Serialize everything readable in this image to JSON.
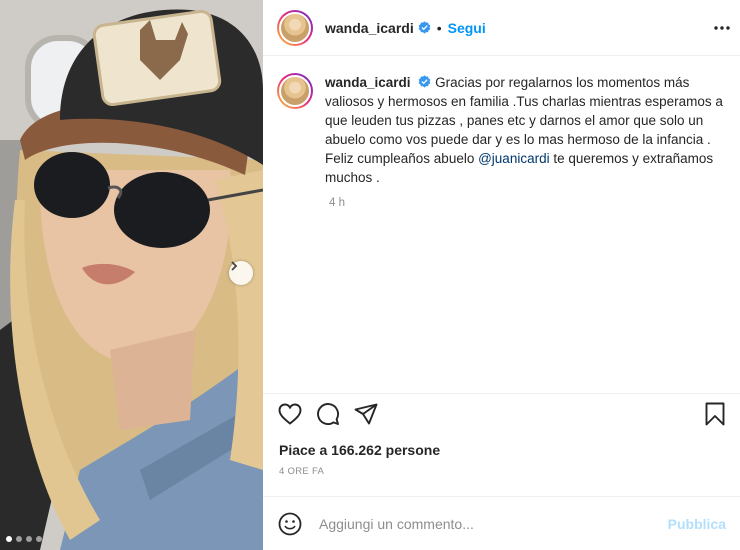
{
  "post": {
    "image_alt": "",
    "carousel_dots": 4,
    "carousel_active": 0
  },
  "header": {
    "username": "wanda_icardi",
    "verified": true,
    "separator": "•",
    "follow_label": "Segui"
  },
  "caption": {
    "username": "wanda_icardi",
    "text_part1": "Gracias por regalarnos los momentos más valiosos y hermosos en familia .Tus charlas mientras esperamos a que leuden tus pizzas , panes etc y darnos el amor que solo un abuelo como vos puede dar y es lo mas hermoso de la infancia . Feliz cumpleaños abuelo ",
    "mention": "@juanicardi",
    "text_part2": " te queremos y extrañamos muchos .",
    "time": "4 h"
  },
  "actions": {
    "like_icon": "heart-icon",
    "comment_icon": "comment-icon",
    "share_icon": "paper-plane-icon",
    "save_icon": "bookmark-icon"
  },
  "likes_text": "Piace a 166.262 persone",
  "time_ago": "4 ORE FA",
  "comment_box": {
    "placeholder": "Aggiungi un commento...",
    "publish_label": "Pubblica"
  },
  "colors": {
    "link_blue": "#0095f6",
    "publish_disabled": "#b2dffc",
    "muted": "#8e8e8e",
    "verified_blue": "#3897f0"
  }
}
